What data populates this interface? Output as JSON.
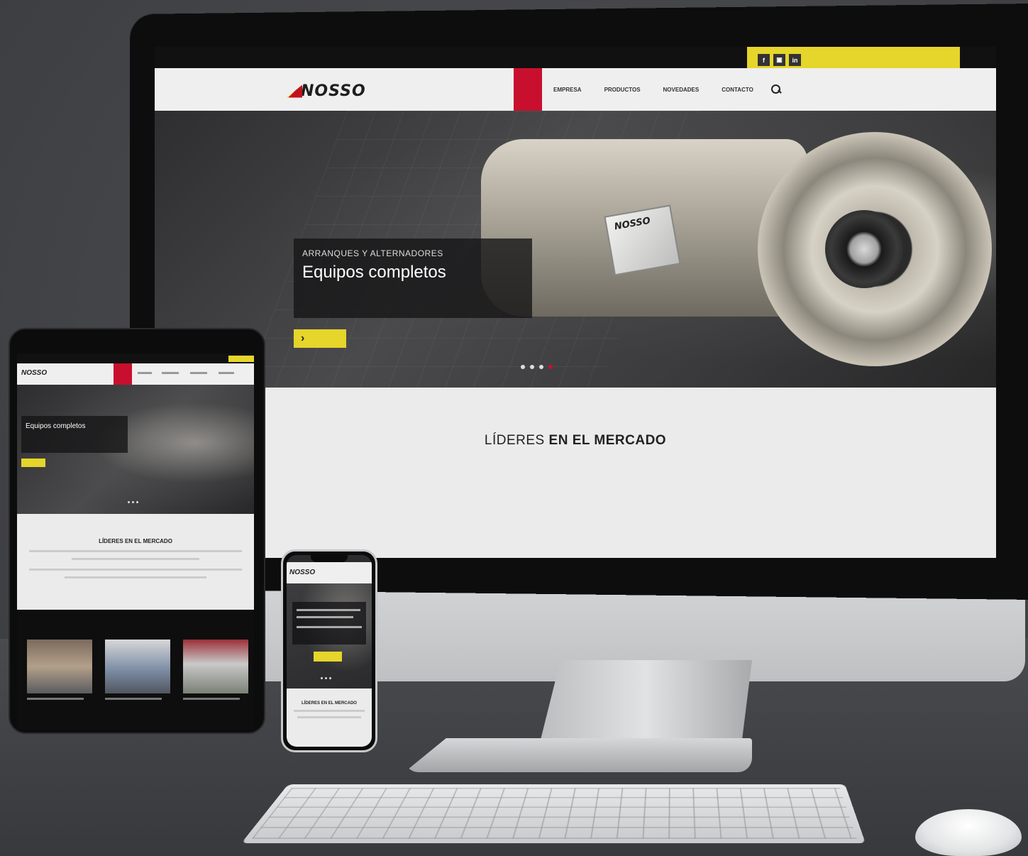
{
  "desktop": {
    "topbar": {
      "small_text": "",
      "access_prefix": "",
      "access_link": "",
      "social": [
        "f",
        "▣",
        "in"
      ]
    },
    "logo_text": "NOSSO",
    "menu": {
      "items": [
        "",
        "EMPRESA",
        "PRODUCTOS",
        "NOVEDADES",
        "CONTACTO"
      ],
      "active_index": 0
    },
    "hero": {
      "kicker": "ARRANQUES Y ALTERNADORES",
      "heading": "Equipos completos",
      "description": "",
      "button_label": "",
      "plate_text": "NOSSO",
      "slide_count": 4,
      "active_slide": 3
    },
    "section": {
      "title_light": "LÍDERES",
      "title_bold": "EN EL MERCADO",
      "paragraph_1": "",
      "paragraph_2": ""
    }
  },
  "tablet": {
    "logo_text": "NOSSO",
    "hero_kicker": "",
    "hero_heading": "Equipos completos",
    "section_title": "LÍDERES EN EL MERCADO",
    "dark_section_title": ""
  },
  "phone": {
    "logo_text": "NOSSO",
    "section_title": "LÍDERES EN EL MERCADO"
  },
  "colors": {
    "brand_red": "#c8102e",
    "brand_yellow": "#e6d52a",
    "dark": "#111111",
    "light_bg": "#ebebeb"
  }
}
